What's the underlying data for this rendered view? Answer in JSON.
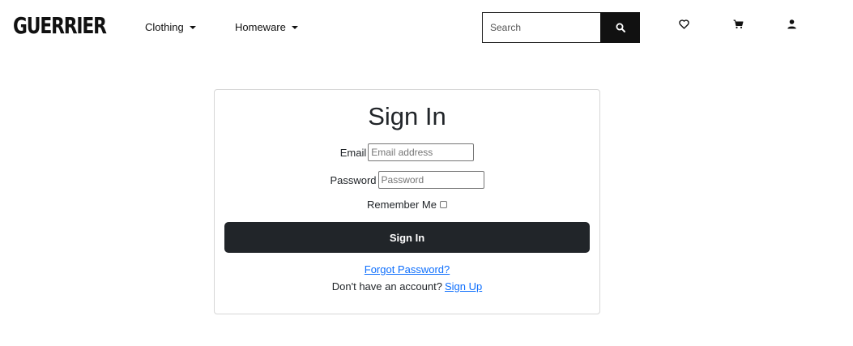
{
  "header": {
    "logo": "GUERRIER",
    "nav": [
      {
        "label": "Clothing"
      },
      {
        "label": "Homeware"
      }
    ],
    "search": {
      "placeholder": "Search",
      "icon": "search-icon"
    },
    "icons": [
      "heart-icon",
      "cart-icon",
      "user-icon"
    ]
  },
  "signin": {
    "title": "Sign In",
    "email_label": "Email",
    "email_placeholder": "Email address",
    "password_label": "Password",
    "password_placeholder": "Password",
    "remember_label": "Remember Me",
    "submit_label": "Sign In",
    "forgot_label": "Forgot Password?",
    "no_account_text": "Don't have an account?",
    "signup_label": "Sign Up"
  },
  "colors": {
    "primary_button": "#212529",
    "link": "#0d6efd",
    "search_button": "#111111"
  }
}
